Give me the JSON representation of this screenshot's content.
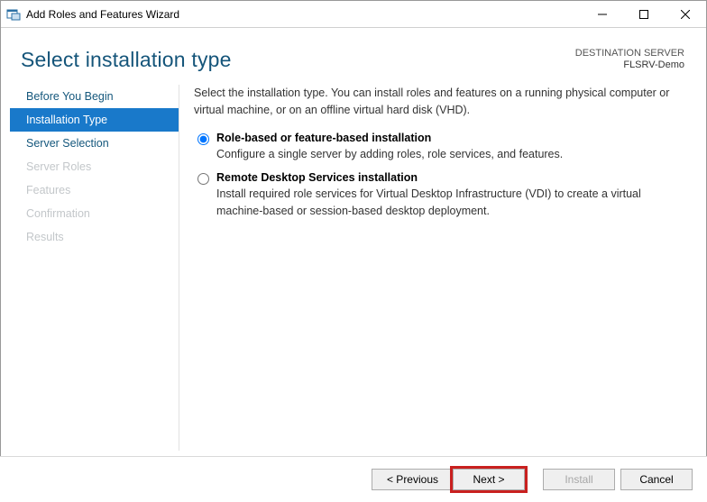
{
  "window": {
    "title": "Add Roles and Features Wizard"
  },
  "header": {
    "title": "Select installation type",
    "destination_label": "DESTINATION SERVER",
    "destination_value": "FLSRV-Demo"
  },
  "sidebar": {
    "items": [
      {
        "label": "Before You Begin",
        "state": "normal"
      },
      {
        "label": "Installation Type",
        "state": "active"
      },
      {
        "label": "Server Selection",
        "state": "normal"
      },
      {
        "label": "Server Roles",
        "state": "disabled"
      },
      {
        "label": "Features",
        "state": "disabled"
      },
      {
        "label": "Confirmation",
        "state": "disabled"
      },
      {
        "label": "Results",
        "state": "disabled"
      }
    ]
  },
  "main": {
    "description": "Select the installation type. You can install roles and features on a running physical computer or virtual machine, or on an offline virtual hard disk (VHD).",
    "options": [
      {
        "label": "Role-based or feature-based installation",
        "subtext": "Configure a single server by adding roles, role services, and features.",
        "selected": true
      },
      {
        "label": "Remote Desktop Services installation",
        "subtext": "Install required role services for Virtual Desktop Infrastructure (VDI) to create a virtual machine-based or session-based desktop deployment.",
        "selected": false
      }
    ]
  },
  "footer": {
    "previous": "< Previous",
    "next": "Next >",
    "install": "Install",
    "cancel": "Cancel"
  }
}
